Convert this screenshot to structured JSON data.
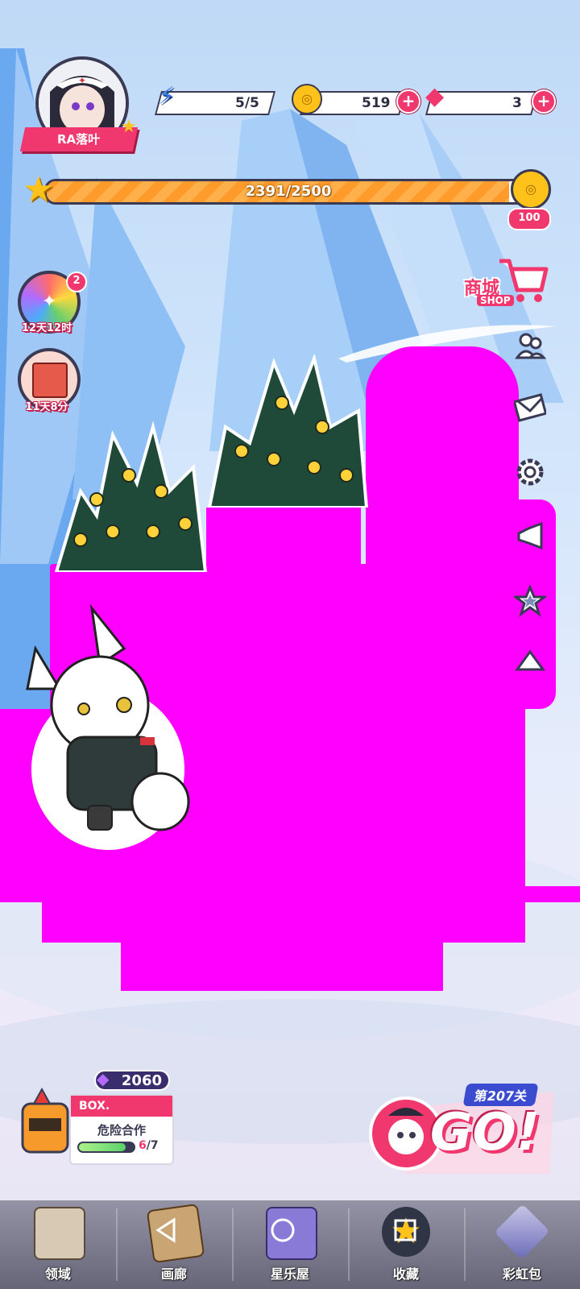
{
  "player": {
    "name": "RA落叶"
  },
  "resources": {
    "energy": "5/5",
    "coins": "519",
    "gems": "3"
  },
  "xp": {
    "text": "2391/2500",
    "progress": 0.9564,
    "reward": "100"
  },
  "events": [
    {
      "name": "rainbow-event",
      "timer": "12天12时",
      "badge": "2"
    },
    {
      "name": "gift-box-event",
      "timer": "11天8分"
    }
  ],
  "shop": {
    "label_cn": "商城",
    "label_en": "SHOP"
  },
  "side_icons": [
    "friends-icon",
    "mail-icon",
    "settings-icon",
    "announcement-icon",
    "star-icon",
    "collapse-arrow-icon"
  ],
  "box_panel": {
    "power": "2060",
    "head": "BOX.",
    "title": "危险合作",
    "progress": "6",
    "total": "/7",
    "fill": 0.857
  },
  "go_button": {
    "level": "第207关",
    "label": "GO!"
  },
  "bottom_tabs": [
    {
      "key": "territory",
      "label": "领域"
    },
    {
      "key": "gallery",
      "label": "画廊"
    },
    {
      "key": "fun-house",
      "label": "星乐屋"
    },
    {
      "key": "collection",
      "label": "收藏"
    },
    {
      "key": "rainbow-pack",
      "label": "彩虹包"
    }
  ],
  "colors": {
    "accent": "#f0386e",
    "outline": "#3a3a55",
    "mask": "#ff00ff",
    "gold": "#ffc21a"
  }
}
